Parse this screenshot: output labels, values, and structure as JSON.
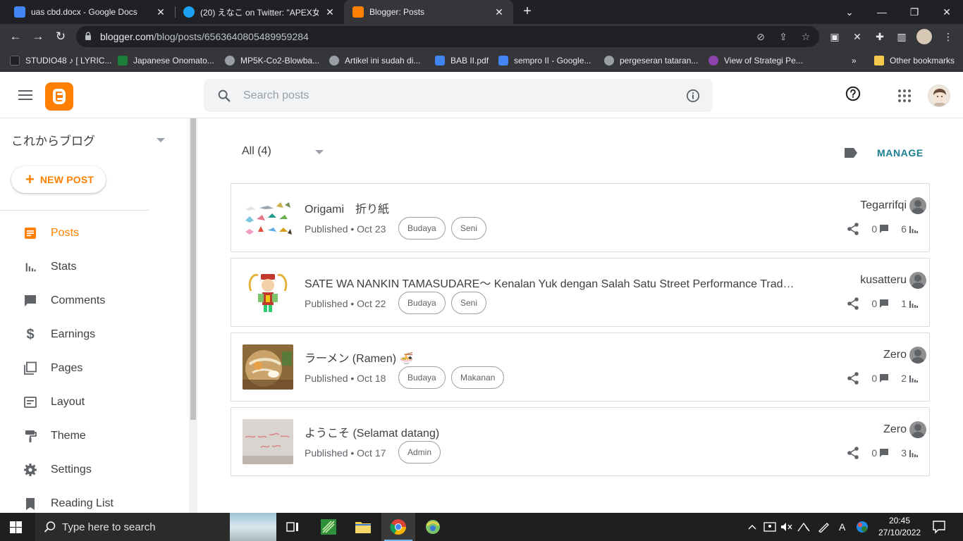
{
  "browser": {
    "tabs": [
      {
        "title": "uas cbd.docx - Google Docs",
        "color": "#4285f4"
      },
      {
        "title": "(20) えなこ on Twitter: \"APEX女子",
        "color": "#1da1f2"
      },
      {
        "title": "Blogger: Posts",
        "color": "#ff8000"
      }
    ],
    "url_domain": "blogger.com",
    "url_path": "/blog/posts/6563640805489959284",
    "bookmarks": [
      {
        "label": "STUDIO48 ♪ [ LYRIC...",
        "color": "#202124"
      },
      {
        "label": "Japanese Onomato...",
        "color": "#1b7f3a"
      },
      {
        "label": "MP5K-Co2-Blowba...",
        "color": "#9aa0a6"
      },
      {
        "label": "Artikel ini sudah di...",
        "color": "#9aa0a6"
      },
      {
        "label": "BAB II.pdf",
        "color": "#4285f4"
      },
      {
        "label": "sempro II - Google...",
        "color": "#4285f4"
      },
      {
        "label": "pergeseran tataran...",
        "color": "#9aa0a6"
      },
      {
        "label": "View of Strategi Pe...",
        "color": "#8e44ad"
      }
    ],
    "bookmarks_more": "»",
    "other_bookmarks": "Other bookmarks"
  },
  "header": {
    "search_placeholder": "Search posts"
  },
  "sidebar": {
    "blog_name": "これからブログ",
    "new_post_label": "NEW POST",
    "items": [
      {
        "label": "Posts",
        "icon": "posts-icon",
        "active": true
      },
      {
        "label": "Stats",
        "icon": "stats-icon"
      },
      {
        "label": "Comments",
        "icon": "comments-icon"
      },
      {
        "label": "Earnings",
        "icon": "earnings-icon"
      },
      {
        "label": "Pages",
        "icon": "pages-icon"
      },
      {
        "label": "Layout",
        "icon": "layout-icon"
      },
      {
        "label": "Theme",
        "icon": "theme-icon"
      },
      {
        "label": "Settings",
        "icon": "settings-icon"
      },
      {
        "label": "Reading List",
        "icon": "reading-list-icon"
      }
    ]
  },
  "main": {
    "filter_label": "All (4)",
    "manage_label": "MANAGE",
    "posts": [
      {
        "title": "Origami　折り紙",
        "meta": "Published • Oct 23",
        "tags": [
          "Budaya",
          "Seni"
        ],
        "author": "Tegarrifqi",
        "comments": "0",
        "views": "6"
      },
      {
        "title": "SATE WA NANKIN TAMASUDARE〜 Kenalan Yuk dengan Salah Satu Street Performance Trad…",
        "meta": "Published • Oct 22",
        "tags": [
          "Budaya",
          "Seni"
        ],
        "author": "kusatteru",
        "comments": "0",
        "views": "1"
      },
      {
        "title": "ラーメン (Ramen) 🍜",
        "meta": "Published • Oct 18",
        "tags": [
          "Budaya",
          "Makanan"
        ],
        "author": "Zero",
        "comments": "0",
        "views": "2"
      },
      {
        "title": "ようこそ (Selamat datang)",
        "meta": "Published • Oct 17",
        "tags": [
          "Admin"
        ],
        "author": "Zero",
        "comments": "0",
        "views": "3"
      }
    ]
  },
  "taskbar": {
    "search_text": "Type here to search",
    "time": "20:45",
    "date": "27/10/2022"
  },
  "colors": {
    "accent": "#ff8000",
    "manage": "#1a7f8e"
  }
}
